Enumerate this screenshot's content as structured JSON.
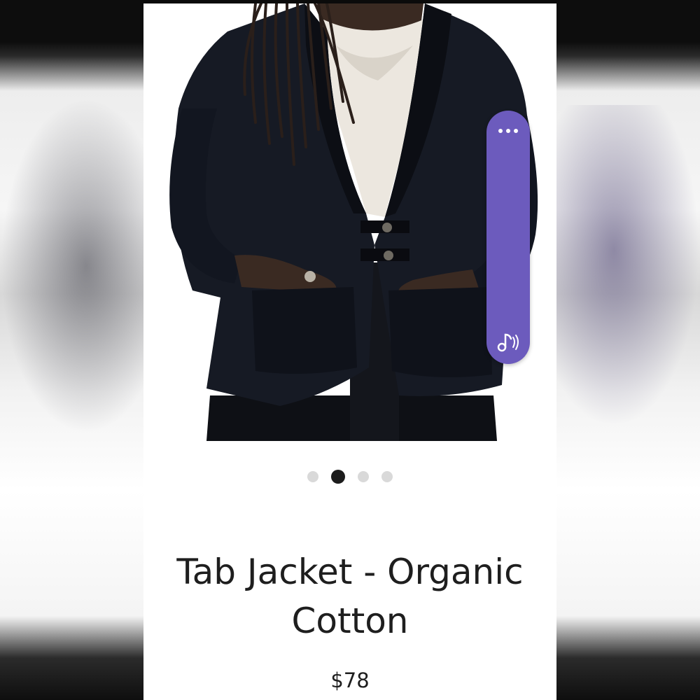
{
  "product": {
    "title": "Tab Jacket - Organic Cotton",
    "price": "$78"
  },
  "gallery": {
    "image_count": 4,
    "active_index": 1,
    "dot_color": "#d9d9d9",
    "active_dot_color": "#1c1c1c"
  },
  "widget": {
    "accent_color": "#6c5bbd",
    "more_icon": "more-horizontal-icon",
    "audio_icon": "music-note-sound-icon"
  }
}
